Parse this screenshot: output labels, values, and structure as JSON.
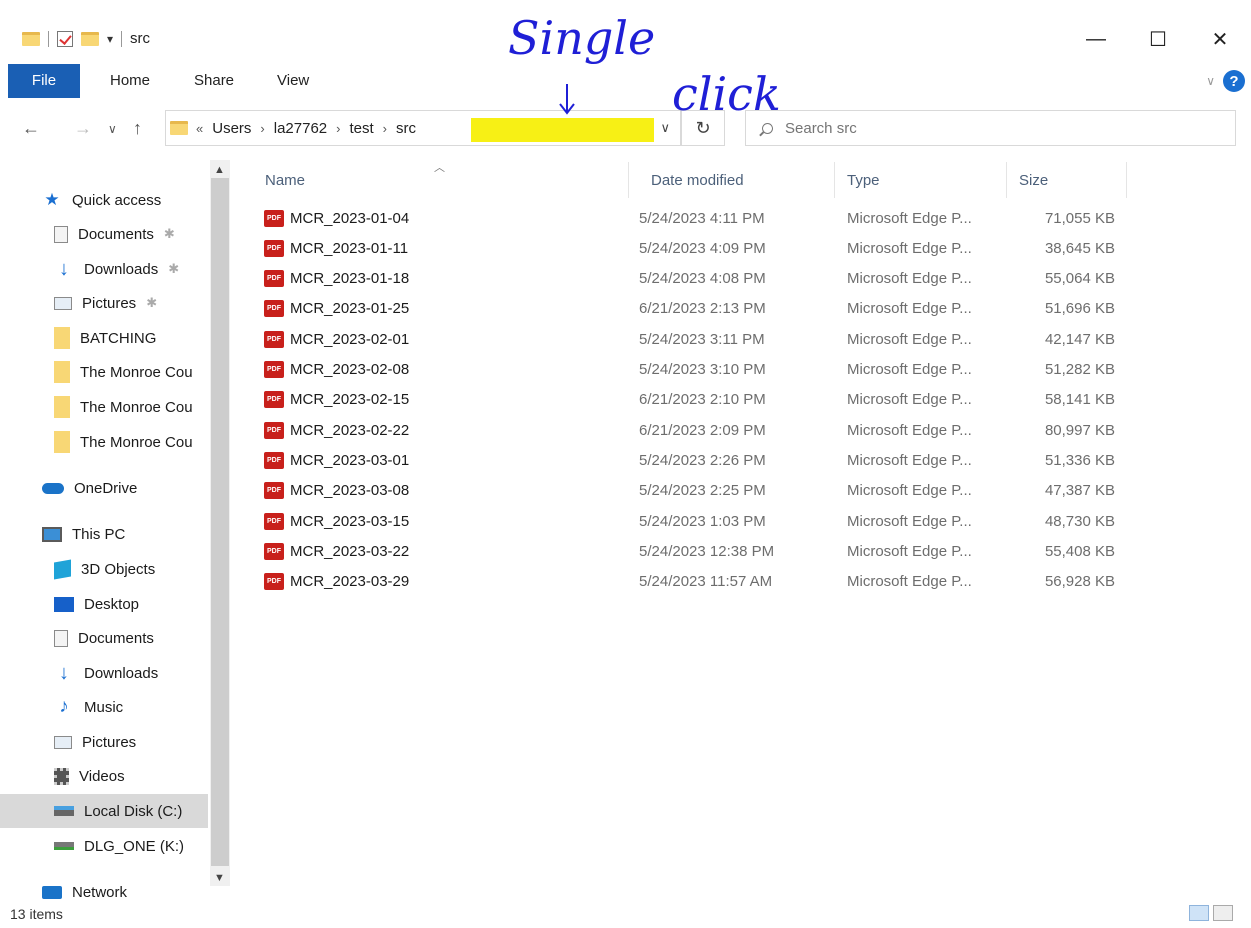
{
  "window": {
    "title": "src",
    "minimize": "—",
    "maximize": "☐",
    "close": "✕"
  },
  "ribbon": {
    "tabs": [
      "File",
      "Home",
      "Share",
      "View"
    ],
    "help": "?"
  },
  "address": {
    "overflow": "«",
    "crumbs": [
      "Users",
      "la27762",
      "test",
      "src"
    ],
    "separator": "›"
  },
  "search": {
    "placeholder": "Search src"
  },
  "annotation": {
    "line1": "Single",
    "line2": "click"
  },
  "sidebar": {
    "items": [
      {
        "label": "Quick access",
        "icon": "star-icon"
      },
      {
        "label": "Documents",
        "icon": "documents-icon",
        "pinned": true
      },
      {
        "label": "Downloads",
        "icon": "downloads-icon",
        "pinned": true
      },
      {
        "label": "Pictures",
        "icon": "pictures-icon",
        "pinned": true
      },
      {
        "label": "BATCHING",
        "icon": "folder-icon"
      },
      {
        "label": "The Monroe Cou",
        "icon": "folder-icon"
      },
      {
        "label": "The Monroe Cou",
        "icon": "folder-icon"
      },
      {
        "label": "The Monroe Cou",
        "icon": "folder-icon"
      },
      {
        "label": "OneDrive",
        "icon": "onedrive-icon"
      },
      {
        "label": "This PC",
        "icon": "this-pc-icon"
      },
      {
        "label": "3D Objects",
        "icon": "3d-objects-icon"
      },
      {
        "label": "Desktop",
        "icon": "desktop-icon"
      },
      {
        "label": "Documents",
        "icon": "documents-icon"
      },
      {
        "label": "Downloads",
        "icon": "downloads-icon"
      },
      {
        "label": "Music",
        "icon": "music-icon"
      },
      {
        "label": "Pictures",
        "icon": "pictures-icon"
      },
      {
        "label": "Videos",
        "icon": "videos-icon"
      },
      {
        "label": "Local Disk (C:)",
        "icon": "local-disk-icon",
        "selected": true
      },
      {
        "label": "DLG_ONE (K:)",
        "icon": "network-drive-icon"
      },
      {
        "label": "Network",
        "icon": "network-icon"
      }
    ]
  },
  "columns": {
    "name": "Name",
    "date": "Date modified",
    "type": "Type",
    "size": "Size"
  },
  "files": [
    {
      "name": "MCR_2023-01-04",
      "date": "5/24/2023 4:11 PM",
      "type": "Microsoft Edge P...",
      "size": "71,055 KB"
    },
    {
      "name": "MCR_2023-01-11",
      "date": "5/24/2023 4:09 PM",
      "type": "Microsoft Edge P...",
      "size": "38,645 KB"
    },
    {
      "name": "MCR_2023-01-18",
      "date": "5/24/2023 4:08 PM",
      "type": "Microsoft Edge P...",
      "size": "55,064 KB"
    },
    {
      "name": "MCR_2023-01-25",
      "date": "6/21/2023 2:13 PM",
      "type": "Microsoft Edge P...",
      "size": "51,696 KB"
    },
    {
      "name": "MCR_2023-02-01",
      "date": "5/24/2023 3:11 PM",
      "type": "Microsoft Edge P...",
      "size": "42,147 KB"
    },
    {
      "name": "MCR_2023-02-08",
      "date": "5/24/2023 3:10 PM",
      "type": "Microsoft Edge P...",
      "size": "51,282 KB"
    },
    {
      "name": "MCR_2023-02-15",
      "date": "6/21/2023 2:10 PM",
      "type": "Microsoft Edge P...",
      "size": "58,141 KB"
    },
    {
      "name": "MCR_2023-02-22",
      "date": "6/21/2023 2:09 PM",
      "type": "Microsoft Edge P...",
      "size": "80,997 KB"
    },
    {
      "name": "MCR_2023-03-01",
      "date": "5/24/2023 2:26 PM",
      "type": "Microsoft Edge P...",
      "size": "51,336 KB"
    },
    {
      "name": "MCR_2023-03-08",
      "date": "5/24/2023 2:25 PM",
      "type": "Microsoft Edge P...",
      "size": "47,387 KB"
    },
    {
      "name": "MCR_2023-03-15",
      "date": "5/24/2023 1:03 PM",
      "type": "Microsoft Edge P...",
      "size": "48,730 KB"
    },
    {
      "name": "MCR_2023-03-22",
      "date": "5/24/2023 12:38 PM",
      "type": "Microsoft Edge P...",
      "size": "55,408 KB"
    },
    {
      "name": "MCR_2023-03-29",
      "date": "5/24/2023 11:57 AM",
      "type": "Microsoft Edge P...",
      "size": "56,928 KB"
    }
  ],
  "file_icon_label": "PDF",
  "status": {
    "item_count": "13 items"
  },
  "colors": {
    "accent": "#1a5fb4",
    "highlight": "#f7f015",
    "pdf": "#c8201b",
    "annotation": "#1f1fd6"
  }
}
